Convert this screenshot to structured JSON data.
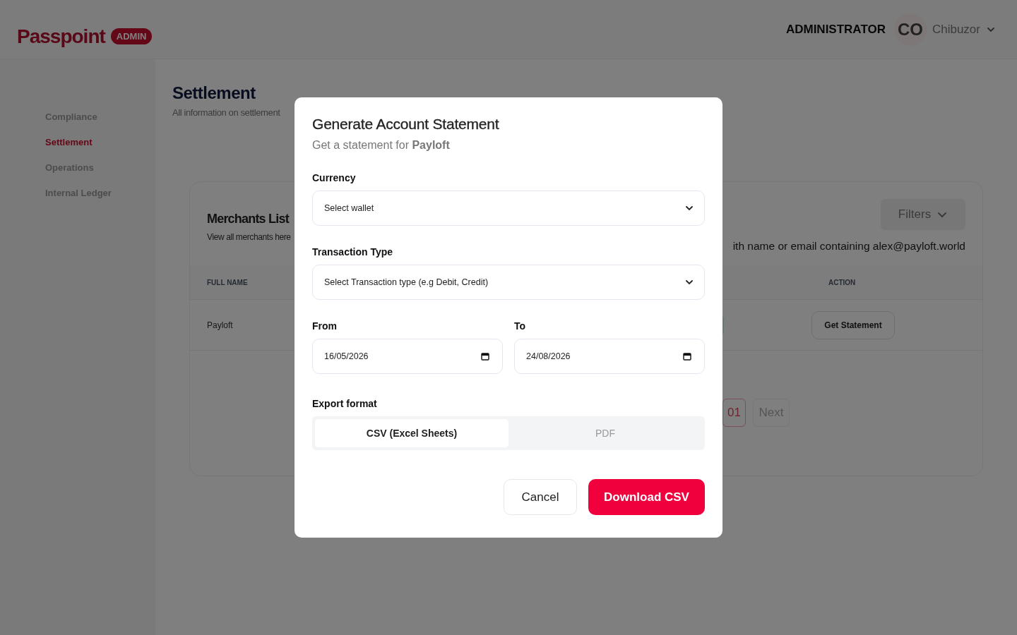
{
  "header": {
    "logo": "Passpoint",
    "badge": "ADMIN",
    "role": "ADMINISTRATOR",
    "avatar_initials": "CO",
    "user_name": "Chibuzor"
  },
  "sidebar": {
    "items": [
      {
        "label": "Compliance",
        "selected": false
      },
      {
        "label": "Settlement",
        "selected": true
      },
      {
        "label": "Operations",
        "selected": false
      },
      {
        "label": "Internal Ledger",
        "selected": false
      }
    ]
  },
  "page": {
    "title": "Settlement",
    "subtitle": "All information on settlement"
  },
  "merchants_card": {
    "title": "Merchants List",
    "subtitle": "View all merchants here",
    "filters_button": "Filters",
    "search_hint": "ith name or email containing alex@payloft.world",
    "table": {
      "columns": [
        "FULL NAME",
        "ACTION"
      ],
      "rows": [
        {
          "full_name": "Payloft",
          "action": "Get Statement"
        }
      ]
    },
    "pagination": {
      "pages": [
        {
          "label": "01",
          "selected": true
        }
      ],
      "next": "Next"
    }
  },
  "modal": {
    "title": "Generate Account Statement",
    "subtitle": "Get a statement for **Payloft**",
    "selects": [
      {
        "label": "Currency",
        "placeholder": "Select wallet"
      },
      {
        "label": "Transaction Type",
        "placeholder": "Select Transaction type (e.g Debit, Credit)"
      }
    ],
    "dates": [
      {
        "label": "From",
        "value": "16/05/2026"
      },
      {
        "label": "To",
        "value": "24/08/2026"
      }
    ],
    "export_format": {
      "label": "Export format",
      "options": [
        {
          "label": "CSV (Excel Sheets)",
          "selected": true
        },
        {
          "label": "PDF",
          "selected": false
        }
      ]
    },
    "buttons": [
      {
        "kind": "secondary",
        "label": "Cancel"
      },
      {
        "kind": "primary",
        "label": "Download CSV"
      }
    ]
  }
}
